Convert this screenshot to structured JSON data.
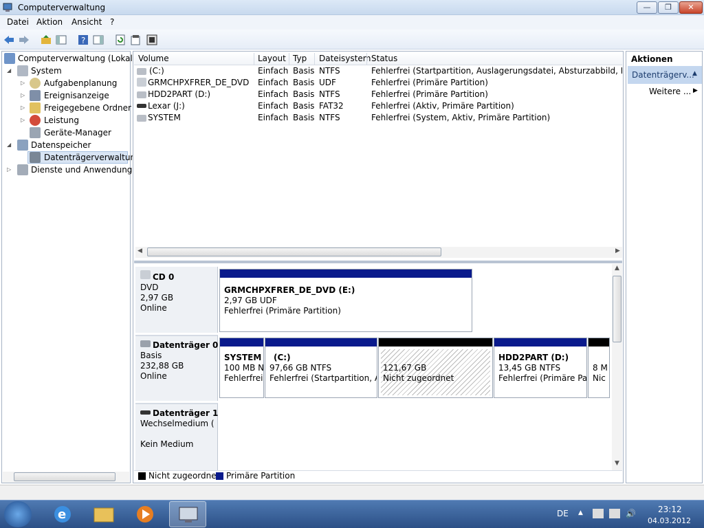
{
  "window": {
    "title": "Computerverwaltung",
    "min": "—",
    "max": "❐",
    "close": "✕"
  },
  "menu": [
    "Datei",
    "Aktion",
    "Ansicht",
    "?"
  ],
  "tree": {
    "items": [
      {
        "label": "Computerverwaltung (Lokal)"
      },
      {
        "label": "System"
      },
      {
        "label": "Aufgabenplanung"
      },
      {
        "label": "Ereignisanzeige"
      },
      {
        "label": "Freigegebene Ordner"
      },
      {
        "label": "Leistung"
      },
      {
        "label": "Geräte-Manager"
      },
      {
        "label": "Datenspeicher"
      },
      {
        "label": "Datenträgerverwaltung"
      },
      {
        "label": "Dienste und Anwendungen"
      }
    ]
  },
  "volumes": {
    "headers": [
      "Volume",
      "Layout",
      "Typ",
      "Dateisystem",
      "Status"
    ],
    "rows": [
      {
        "volume": "(C:)",
        "layout": "Einfach",
        "typ": "Basis",
        "fs": "NTFS",
        "status": "Fehlerfrei (Startpartition, Auslagerungsdatei, Absturzabbild, Primäre P"
      },
      {
        "volume": "GRMCHPXFRER_DE_DVD (E:)",
        "layout": "Einfach",
        "typ": "Basis",
        "fs": "UDF",
        "status": "Fehlerfrei (Primäre Partition)"
      },
      {
        "volume": "HDD2PART (D:)",
        "layout": "Einfach",
        "typ": "Basis",
        "fs": "NTFS",
        "status": "Fehlerfrei (Primäre Partition)"
      },
      {
        "volume": "Lexar (J:)",
        "layout": "Einfach",
        "typ": "Basis",
        "fs": "FAT32",
        "status": "Fehlerfrei (Aktiv, Primäre Partition)"
      },
      {
        "volume": "SYSTEM",
        "layout": "Einfach",
        "typ": "Basis",
        "fs": "NTFS",
        "status": "Fehlerfrei (System, Aktiv, Primäre Partition)"
      }
    ]
  },
  "disks": {
    "cd0": {
      "name": "CD 0",
      "type": "DVD",
      "size": "2,97 GB",
      "state": "Online",
      "part": {
        "title": "GRMCHPXFRER_DE_DVD  (E:)",
        "line2": "2,97 GB UDF",
        "line3": "Fehlerfrei (Primäre Partition)"
      }
    },
    "disk0": {
      "name": "Datenträger 0",
      "type": "Basis",
      "size": "232,88 GB",
      "state": "Online",
      "parts": [
        {
          "title": "SYSTEM",
          "line2": "100 MB N",
          "line3": "Fehlerfrei"
        },
        {
          "title": "(C:)",
          "line2": "97,66 GB NTFS",
          "line3": "Fehlerfrei (Startpartition, Aus"
        },
        {
          "title": "",
          "line2": "121,67 GB",
          "line3": "Nicht zugeordnet"
        },
        {
          "title": "HDD2PART  (D:)",
          "line2": "13,45 GB NTFS",
          "line3": "Fehlerfrei (Primäre Part"
        },
        {
          "title": "",
          "line2": "8 M",
          "line3": "Nic"
        }
      ]
    },
    "disk1": {
      "name": "Datenträger 1",
      "type": "Wechselmedium (F:)",
      "state": "Kein Medium"
    }
  },
  "legend": {
    "unallocated": "Nicht zugeordnet",
    "primary": "Primäre Partition"
  },
  "actions": {
    "header": "Aktionen",
    "selected": "Datenträgerv...",
    "more": "Weitere ..."
  },
  "taskbar": {
    "lang": "DE",
    "time": "23:12",
    "date": "04.03.2012"
  },
  "colors": {
    "primary_partition": "#0a1a8c",
    "unallocated": "#000000",
    "selection": "#c4d7ef"
  }
}
